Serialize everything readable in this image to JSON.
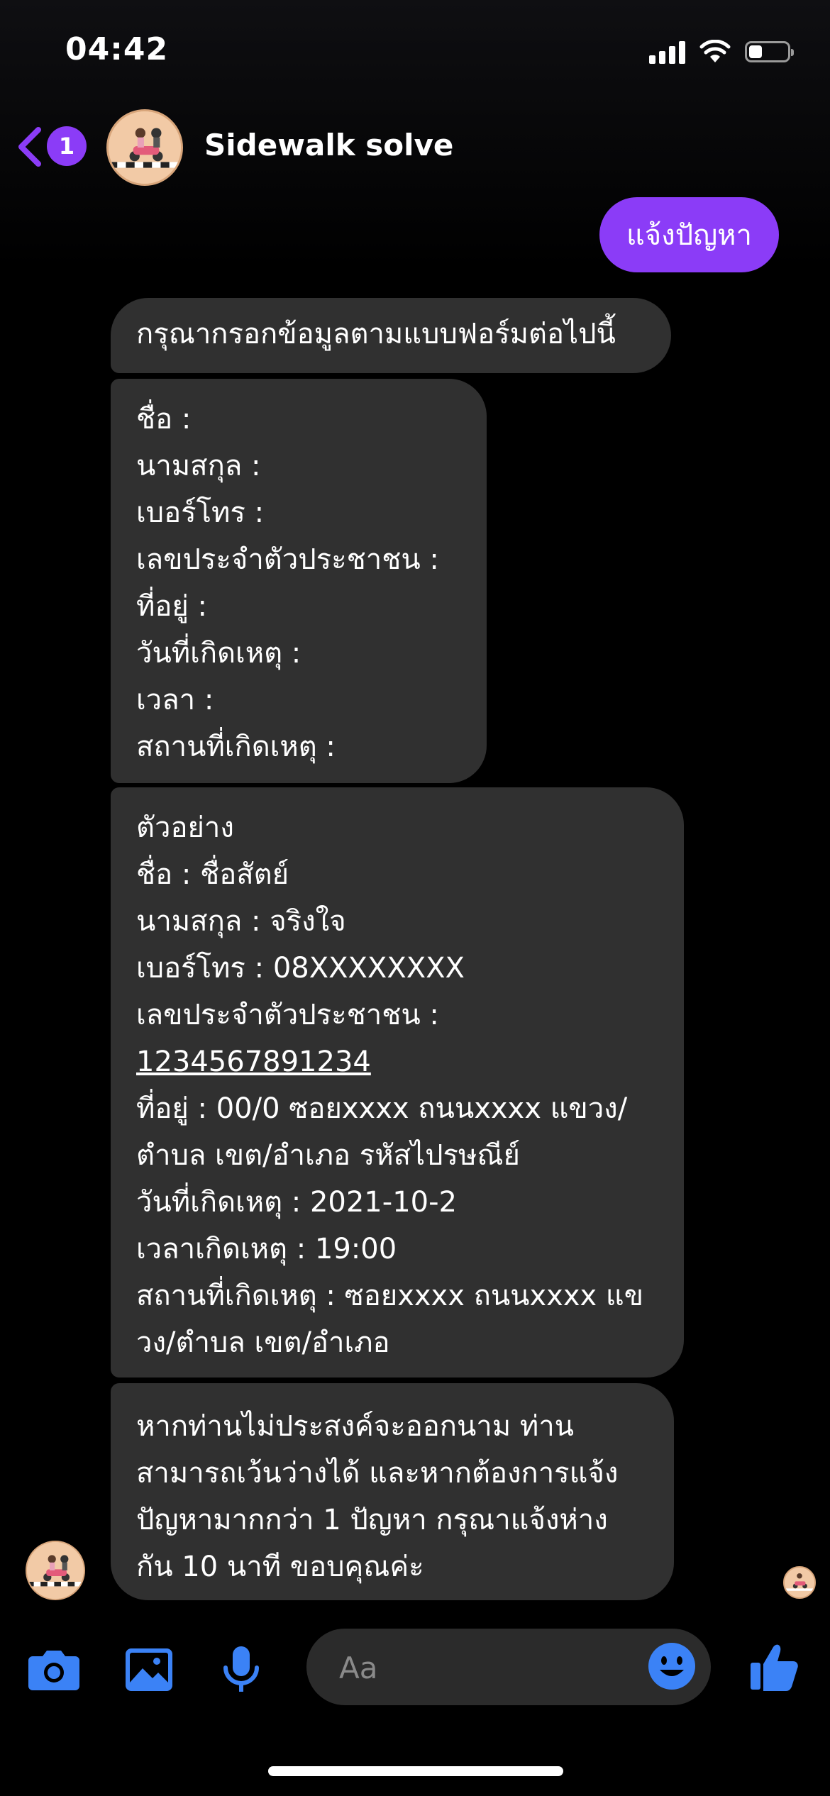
{
  "status_bar": {
    "time": "04:42",
    "battery_level": 0.35
  },
  "header": {
    "unread_count": "1",
    "title": "Sidewalk solve",
    "accent_color": "#8b3cf7"
  },
  "messages": {
    "outgoing": "แจ้งปัญหา",
    "intro": "กรุณากรอกข้อมูลตามแบบฟอร์มต่อไปนี้",
    "form_lines": [
      "ชื่อ :",
      "นามสกุล :",
      "เบอร์โทร  :",
      "เลขประจำตัวประชาชน :",
      "ที่อยู่ :",
      "วันที่เกิดเหตุ :",
      "เวลา :",
      "สถานที่เกิดเหตุ :"
    ],
    "example_lines": [
      "ตัวอย่าง",
      "ชื่อ : ชื่อสัตย์",
      "นามสกุล : จริงใจ",
      "เบอร์โทร  : 08XXXXXXXX",
      "เลขประจำตัวประชาชน  :",
      "1234567891234",
      "ที่อยู่ : 00/0 ซอยxxxx ถนนxxxx แขวง/",
      "ตำบล เขต/อำเภอ รหัสไปรษณีย์",
      "วันที่เกิดเหตุ : 2021-10-2",
      "เวลาเกิดเหตุ : 19:00",
      "สถานที่เกิดเหตุ : ซอยxxxx ถนนxxxx แข",
      "วง/ตำบล เขต/อำเภอ"
    ],
    "note_lines": [
      "หากท่านไม่ประสงค์จะออกนาม ท่าน",
      "สามารถเว้นว่างได้  และหากต้องการแจ้ง",
      "ปัญหามากกว่า 1 ปัญหา กรุณาแจ้งห่าง",
      "กัน 10 นาที ขอบคุณค่ะ"
    ]
  },
  "composer": {
    "placeholder": "Aa",
    "icons": [
      "camera-icon",
      "image-icon",
      "microphone-icon",
      "emoji-icon",
      "thumbs-up-icon"
    ],
    "icon_color": "#3b82f6"
  }
}
